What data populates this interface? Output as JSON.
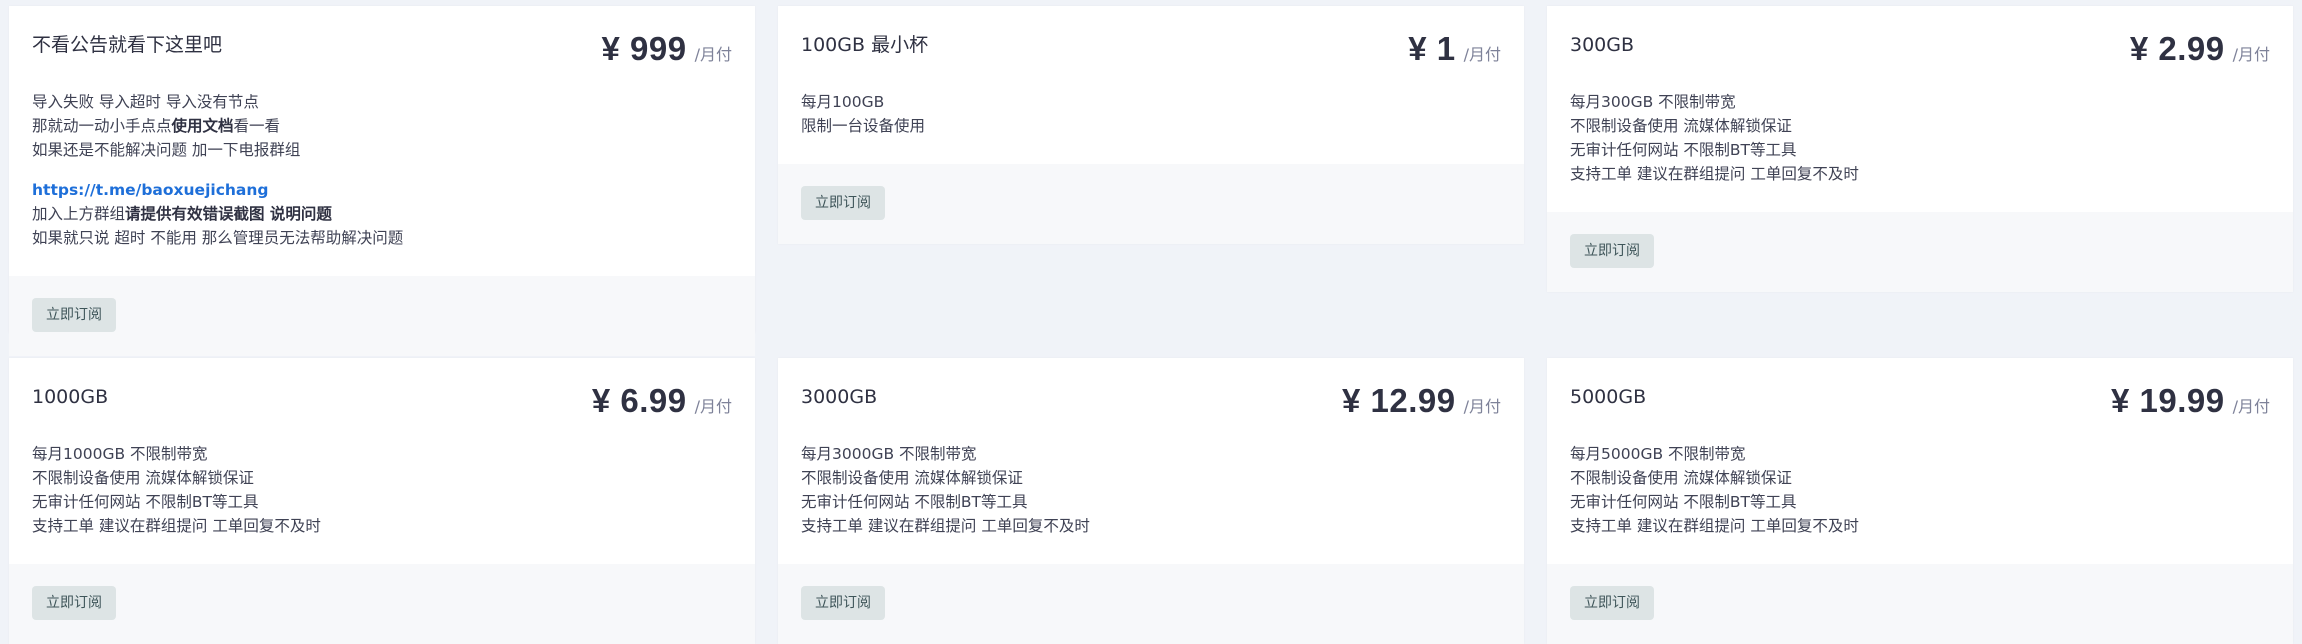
{
  "currency_symbol": "¥",
  "period_label": "/月付",
  "button_label": "立即订阅",
  "plans": [
    {
      "title": "不看公告就看下这里吧",
      "price": "999",
      "lines": [
        "导入失败 导入超时 导入没有节点"
      ],
      "line2_prefix": "那就动一动小手点点",
      "line2_bold": "使用文档",
      "line2_suffix": "看一看",
      "line3": "如果还是不能解决问题 加一下电报群组",
      "link": "https://t.me/baoxuejichang",
      "line5_prefix": "加入上方群组",
      "line5_bold": "请提供有效错误截图 说明问题",
      "line6": "如果就只说 超时 不能用 那么管理员无法帮助解决问题"
    },
    {
      "title": "100GB 最小杯",
      "price": "1",
      "lines": [
        "每月100GB",
        "限制一台设备使用"
      ]
    },
    {
      "title": "300GB",
      "price": "2.99",
      "lines": [
        "每月300GB 不限制带宽",
        "不限制设备使用 流媒体解锁保证",
        "无审计任何网站 不限制BT等工具",
        "支持工单 建议在群组提问 工单回复不及时"
      ]
    },
    {
      "title": "1000GB",
      "price": "6.99",
      "lines": [
        "每月1000GB 不限制带宽",
        "不限制设备使用 流媒体解锁保证",
        "无审计任何网站 不限制BT等工具",
        "支持工单 建议在群组提问 工单回复不及时"
      ]
    },
    {
      "title": "3000GB",
      "price": "12.99",
      "lines": [
        "每月3000GB 不限制带宽",
        "不限制设备使用 流媒体解锁保证",
        "无审计任何网站 不限制BT等工具",
        "支持工单 建议在群组提问 工单回复不及时"
      ]
    },
    {
      "title": "5000GB",
      "price": "19.99",
      "lines": [
        "每月5000GB 不限制带宽",
        "不限制设备使用 流媒体解锁保证",
        "无审计任何网站 不限制BT等工具",
        "支持工单 建议在群组提问 工单回复不及时"
      ]
    }
  ]
}
